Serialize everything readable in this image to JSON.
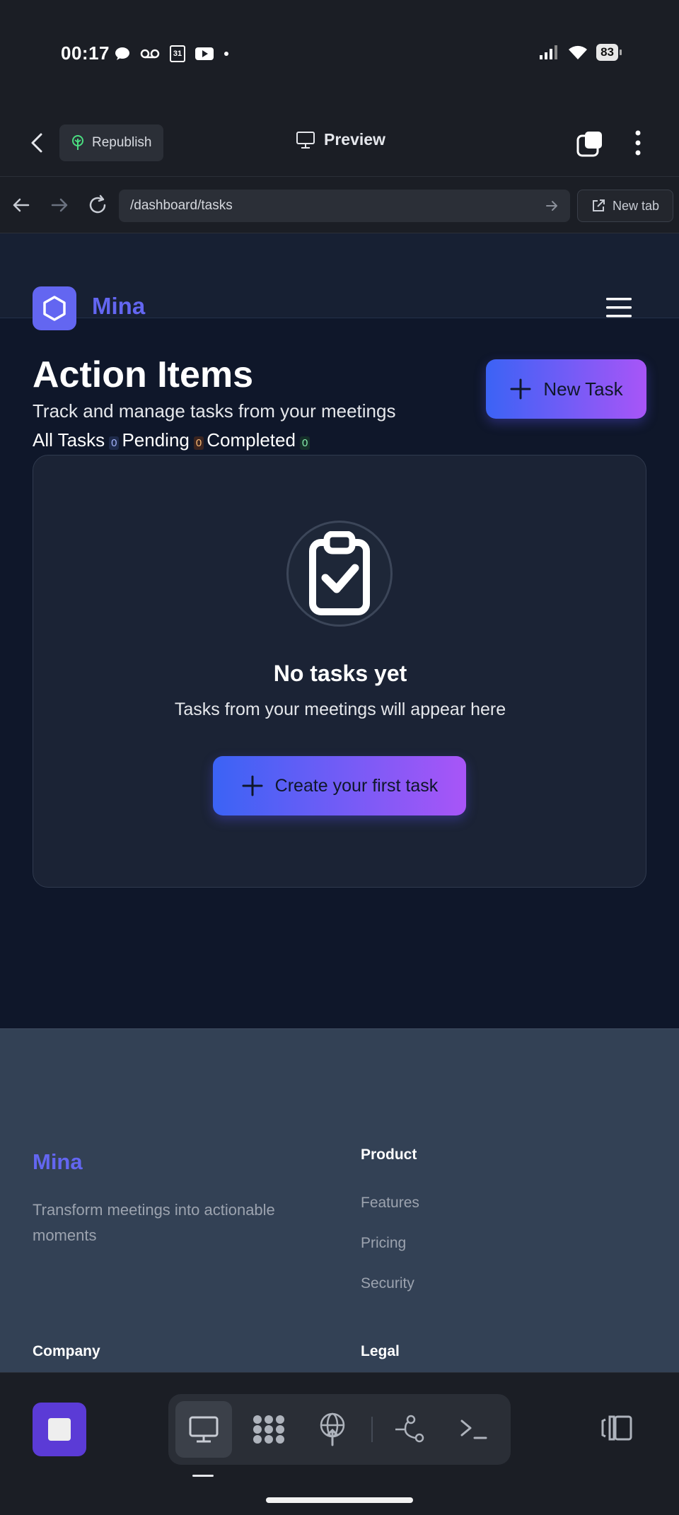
{
  "status_bar": {
    "time": "00:17",
    "calendar_day": "31",
    "battery": "83"
  },
  "app_bar": {
    "republish_label": "Republish",
    "preview_label": "Preview"
  },
  "browser": {
    "url": "/dashboard/tasks",
    "new_tab_label": "New tab"
  },
  "site": {
    "brand": "Mina",
    "page_title": "Action Items",
    "subtitle": "Track and manage tasks from your meetings",
    "filters": [
      {
        "label": "All Tasks",
        "count": "0"
      },
      {
        "label": "Pending",
        "count": "0"
      },
      {
        "label": "Completed",
        "count": "0"
      }
    ],
    "new_task_label": "New Task",
    "empty_state": {
      "title": "No tasks yet",
      "text": "Tasks from your meetings will appear here",
      "button_label": "Create your first task"
    },
    "footer": {
      "brand": "Mina",
      "tagline": "Transform meetings into actionable moments",
      "product_heading": "Product",
      "product_links": [
        "Features",
        "Pricing",
        "Security"
      ],
      "company_heading": "Company",
      "legal_heading": "Legal"
    }
  },
  "colors": {
    "brand": "#6366f1",
    "gradient_start": "#3b63f5",
    "gradient_end": "#a855f7",
    "page_bg": "#0f172a",
    "footer_bg": "#334155"
  },
  "icons": {
    "bottom_tools": [
      "monitor-icon",
      "apps-icon",
      "deploy-icon",
      "git-branch-icon",
      "terminal-icon"
    ]
  }
}
